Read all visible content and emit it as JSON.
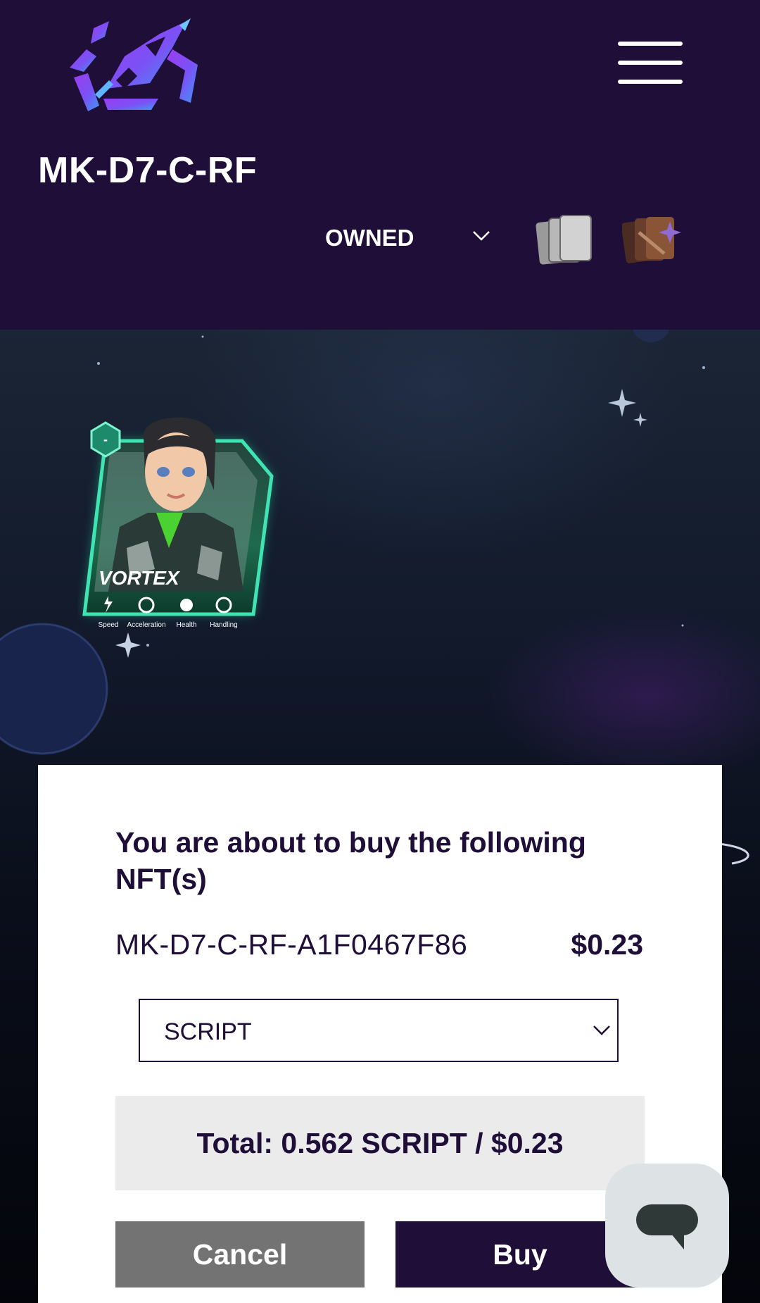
{
  "header": {
    "title": "MK-D7-C-RF",
    "filter": {
      "selected": "OWNED"
    },
    "logo_icon": "rocket-hexagon-logo",
    "menu_icon": "hamburger-menu-icon",
    "view_icons": [
      "card-stack-icon",
      "card-pack-icon"
    ]
  },
  "nft_card": {
    "name": "VORTEX",
    "level": "-",
    "stats": [
      "Speed",
      "Acceleration",
      "Health",
      "Handling"
    ]
  },
  "purchase_modal": {
    "heading": "You are about to buy the following NFT(s)",
    "item_id": "MK-D7-C-RF-A1F0467F86",
    "item_price": "$0.23",
    "currency": "SCRIPT",
    "total": "Total: 0.562 SCRIPT / $0.23",
    "cancel_label": "Cancel",
    "buy_label": "Buy"
  },
  "chat": {
    "icon": "chat-bubble-icon"
  },
  "colors": {
    "header_bg": "#1e0e38",
    "primary": "#1e0e38",
    "cancel_gray": "#737373",
    "card_green": "#2fd0a0"
  }
}
